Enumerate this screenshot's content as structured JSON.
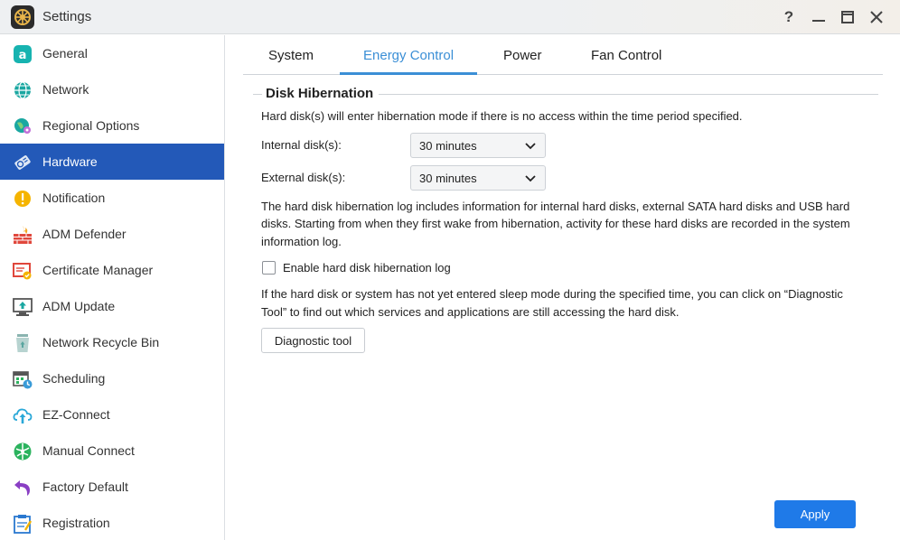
{
  "window": {
    "title": "Settings",
    "help_glyph": "?",
    "icon": "settings-gear-icon"
  },
  "sidebar": {
    "items": [
      {
        "label": "General",
        "icon": "general-icon",
        "color": "#17b3b0"
      },
      {
        "label": "Network",
        "icon": "globe-icon",
        "color": "#1aa7a1"
      },
      {
        "label": "Regional Options",
        "icon": "regional-globe-icon",
        "color": "#1aa7a1"
      },
      {
        "label": "Hardware",
        "icon": "hardware-disk-icon",
        "color": "#ffffff"
      },
      {
        "label": "Notification",
        "icon": "alert-icon",
        "color": "#f5b400"
      },
      {
        "label": "ADM Defender",
        "icon": "firewall-icon",
        "color": "#e0473c"
      },
      {
        "label": "Certificate Manager",
        "icon": "certificate-icon",
        "color": "#e0473c"
      },
      {
        "label": "ADM Update",
        "icon": "update-icon",
        "color": "#1aa7a1"
      },
      {
        "label": "Network Recycle Bin",
        "icon": "recycle-bin-icon",
        "color": "#8ab4b0"
      },
      {
        "label": "Scheduling",
        "icon": "calendar-clock-icon",
        "color": "#3a9bd8"
      },
      {
        "label": "EZ-Connect",
        "icon": "cloud-upload-icon",
        "color": "#2aa8d8"
      },
      {
        "label": "Manual Connect",
        "icon": "connect-globe-icon",
        "color": "#2bb35e"
      },
      {
        "label": "Factory Default",
        "icon": "undo-arrow-icon",
        "color": "#8a3fc4"
      },
      {
        "label": "Registration",
        "icon": "clipboard-icon",
        "color": "#2a78d0"
      }
    ],
    "active_index": 3,
    "active_color": "#2359b8"
  },
  "tabs": [
    {
      "label": "System"
    },
    {
      "label": "Energy Control"
    },
    {
      "label": "Power"
    },
    {
      "label": "Fan Control"
    }
  ],
  "active_tab": "Energy Control",
  "accent_color": "#3b8fd6",
  "section": {
    "title": "Disk Hibernation",
    "intro": "Hard disk(s) will enter hibernation mode if there is no access within the time period specified.",
    "internal_label": "Internal disk(s):",
    "internal_value": "30 minutes",
    "external_label": "External disk(s):",
    "external_value": "30 minutes",
    "log_info_line1": "The hard disk hibernation log includes information for internal hard disks, external SATA hard disks and USB hard",
    "log_info_line2": "disks. Starting from when they first wake from hibernation, activity for these hard disks are recorded in the system",
    "log_info_line3": "information log.",
    "checkbox_label": "Enable hard disk hibernation log",
    "checkbox_checked": false,
    "diag_info_line1": "If the hard disk or system has not yet entered sleep mode during the specified time, you can click on “Diagnostic",
    "diag_info_line2": "Tool” to find out which services and applications are still accessing the hard disk.",
    "diag_button": "Diagnostic tool"
  },
  "apply_button": "Apply",
  "apply_color": "#1f7ae8"
}
